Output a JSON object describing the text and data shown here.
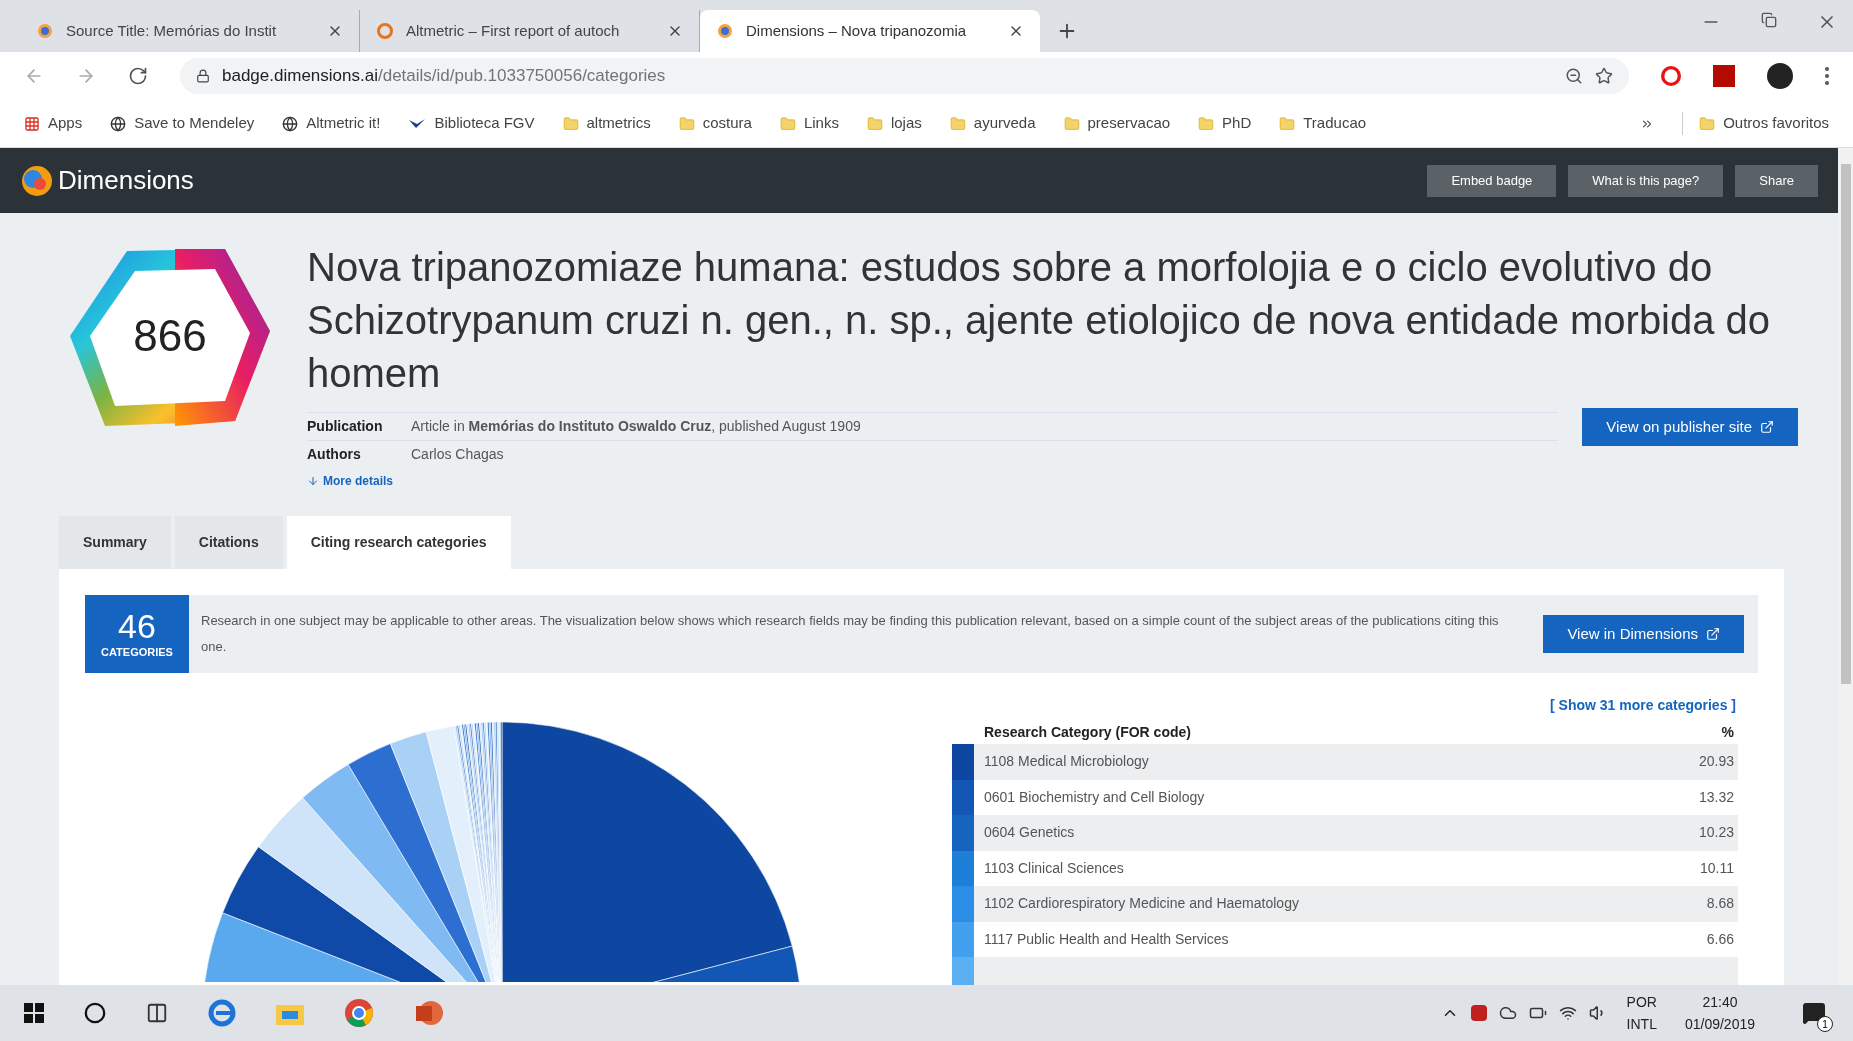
{
  "browser": {
    "tabs": [
      {
        "title": "Source Title: Memórias do Instit",
        "selected": false,
        "kind": "web"
      },
      {
        "title": "Altmetric – First report of autoch",
        "selected": false,
        "kind": "ring"
      },
      {
        "title": "Dimensions – Nova tripanozomia",
        "selected": true,
        "kind": "web"
      }
    ],
    "url_host": "badge.dimensions.ai",
    "url_path": "/details/id/pub.1033750056/categories",
    "bookmarks": [
      {
        "label": "Apps",
        "kind": "apps"
      },
      {
        "label": "Save to Mendeley",
        "kind": "site"
      },
      {
        "label": "Altmetric it!",
        "kind": "site"
      },
      {
        "label": "Biblioteca FGV",
        "kind": "bird"
      },
      {
        "label": "altmetrics",
        "kind": "folder"
      },
      {
        "label": "costura",
        "kind": "folder"
      },
      {
        "label": "Links",
        "kind": "folder"
      },
      {
        "label": "lojas",
        "kind": "folder"
      },
      {
        "label": "ayurveda",
        "kind": "folder"
      },
      {
        "label": "preservacao",
        "kind": "folder"
      },
      {
        "label": "PhD",
        "kind": "folder"
      },
      {
        "label": "Traducao",
        "kind": "folder"
      }
    ],
    "other_bookmarks": "Outros favoritos"
  },
  "header": {
    "brand": "Dimensions",
    "buttons": [
      "Embed badge",
      "What is this page?",
      "Share"
    ]
  },
  "publication": {
    "score": "866",
    "title": "Nova tripanozomiaze humana: estudos sobre a morfolojia e o ciclo evolutivo do Schizotrypanum cruzi n. gen., n. sp., ajente etiolojico de nova entidade morbida do homem",
    "details": [
      {
        "label": "Publication",
        "value": "Article in **Memórias do Instituto Oswaldo Cruz**, published August 1909"
      },
      {
        "label": "Authors",
        "value": "Carlos Chagas"
      }
    ],
    "more_details": "More details",
    "publisher_button": "View on publisher site"
  },
  "tabs": [
    {
      "label": "Summary",
      "selected": false
    },
    {
      "label": "Citations",
      "selected": false
    },
    {
      "label": "Citing research categories",
      "selected": true
    }
  ],
  "categories": {
    "count": "46",
    "count_label": "CATEGORIES",
    "description": "Research in one subject may be applicable to other areas. The visualization below shows which research fields may be finding this publication relevant, based on a simple count of the subject areas of the publications citing this one.",
    "dimensions_button": "View in Dimensions",
    "show_more": "[ Show 31 more categories ]",
    "columns": [
      "Research Category (FOR code)",
      "%"
    ],
    "rows": [
      {
        "name": "1108 Medical Microbiology",
        "percent": "20.93",
        "color": "#0d47a1"
      },
      {
        "name": "0601 Biochemistry and Cell Biology",
        "percent": "13.32",
        "color": "#1257b5"
      },
      {
        "name": "0604 Genetics",
        "percent": "10.23",
        "color": "#1565c0"
      },
      {
        "name": "1103 Clinical Sciences",
        "percent": "10.11",
        "color": "#1e7fd8"
      },
      {
        "name": "1102 Cardiorespiratory Medicine and Haematology",
        "percent": "8.68",
        "color": "#2a8ee6"
      },
      {
        "name": "1117 Public Health and Health Services",
        "percent": "6.66",
        "color": "#42a0ee"
      }
    ]
  },
  "taskbar": {
    "language": "POR",
    "layout": "INTL",
    "time": "21:40",
    "date": "01/09/2019",
    "notifications": "1"
  }
}
